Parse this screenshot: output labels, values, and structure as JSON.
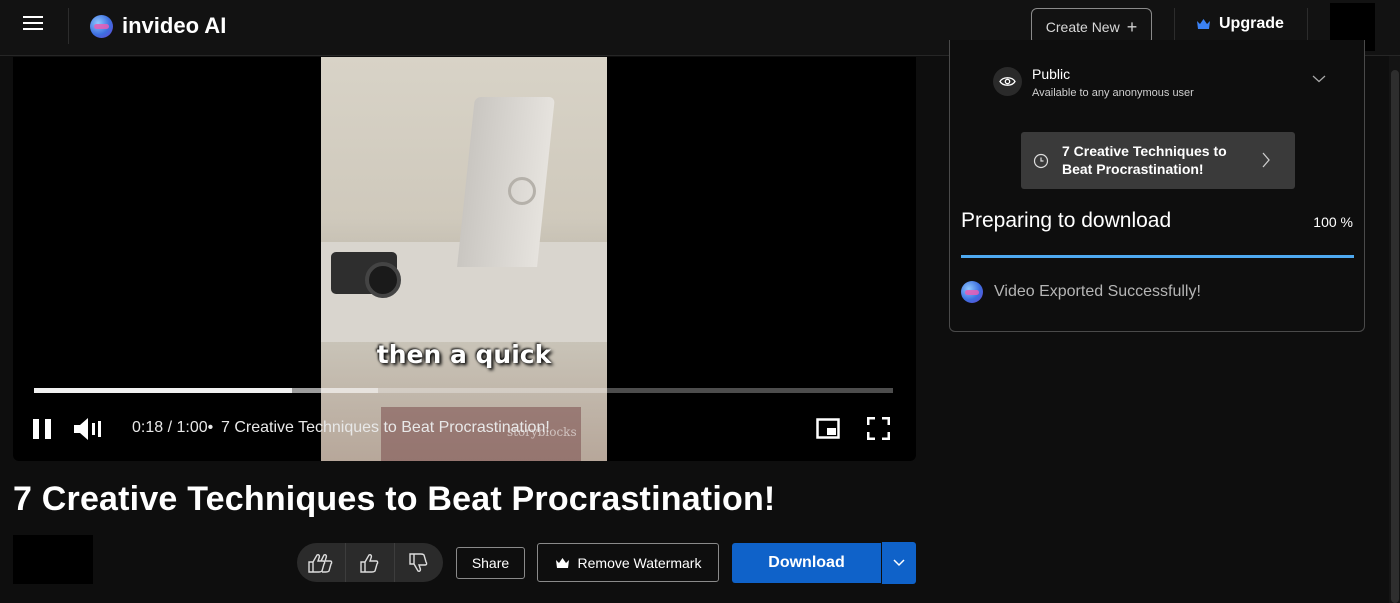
{
  "header": {
    "app_name": "invideo AI",
    "create_new_label": "Create New",
    "upgrade_label": "Upgrade",
    "icons": {
      "menu": "hamburger-menu-icon",
      "logo": "invideo-logo-icon",
      "plus": "plus-icon",
      "crown": "crown-icon"
    },
    "upgrade_color": "#3b82f6"
  },
  "player": {
    "caption": "then a quick",
    "watermark": "storyblocks",
    "current_time": "0:18",
    "duration": "1:00",
    "time_display": "0:18 / 1:00",
    "separator": "•",
    "title_overlay": "7 Creative Techniques to Beat Procrastination!",
    "played_fraction": 0.3,
    "buffered_fraction": 0.4
  },
  "video_title": "7 Creative Techniques to Beat Procrastination!",
  "actions": {
    "share_label": "Share",
    "remove_watermark_label": "Remove Watermark",
    "download_label": "Download",
    "download_color": "#0f62c9",
    "rating_icons": [
      "double-thumbs-up-icon",
      "thumbs-up-icon",
      "thumbs-down-icon"
    ]
  },
  "panel": {
    "visibility_label": "Public",
    "visibility_desc": "Available to any anonymous user",
    "task_title": "7 Creative Techniques to Beat Procrastination!",
    "status_title": "Preparing to download",
    "progress_percent": "100 %",
    "progress_value": 1.0,
    "success_message": "Video Exported Successfully!",
    "accent": "#4ea9f0"
  }
}
